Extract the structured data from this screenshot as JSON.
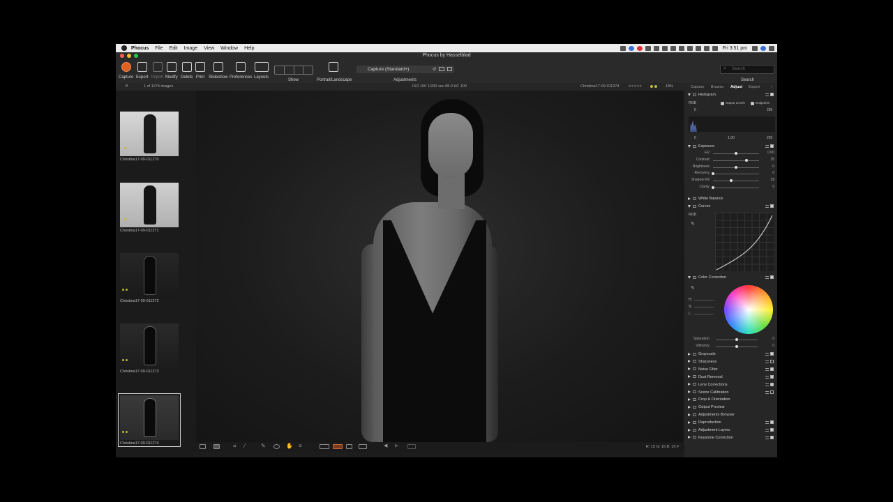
{
  "menubar": {
    "app": "Phocus",
    "items": [
      "File",
      "Edit",
      "Image",
      "View",
      "Window",
      "Help"
    ],
    "clock": "Fri 3:51 pm"
  },
  "window": {
    "title": "Phocus by Hasselblad"
  },
  "toolbar": {
    "buttons": [
      "Capture",
      "Export",
      "Import",
      "Modify",
      "Delete",
      "Print",
      "Slideshow",
      "Preferences",
      "Layouts"
    ],
    "show_label": "Show",
    "portrait_label": "Portrait/Landscape",
    "recipe_value": "Capture (Standard+)",
    "adjustments_label": "Adjustments",
    "search_placeholder": "Search",
    "search_label": "Search"
  },
  "infobar": {
    "filter": "ff",
    "count": "1 of 1274 images",
    "exposure": "ISO 100  1/200 sec  f/8.0  HC 100",
    "filename": "Christina17-09-011274",
    "zoom": "18%"
  },
  "thumbnails": [
    {
      "name": "Christina17-09-011270",
      "tone": "light"
    },
    {
      "name": "Christina17-09-011271",
      "tone": "light"
    },
    {
      "name": "Christina17-09-011272",
      "tone": "dark"
    },
    {
      "name": "Christina17-09-011273",
      "tone": "dark"
    },
    {
      "name": "Christina17-09-011274",
      "tone": "dark",
      "selected": true
    }
  ],
  "panel": {
    "tabs": [
      "Capture",
      "Browse",
      "Adjust",
      "Export"
    ],
    "active_tab": "Adjust",
    "histogram": {
      "title": "Histogram",
      "channel": "RGB",
      "output_levels": "Output Levels",
      "endpoints": "Endpoints",
      "min": "0",
      "max": "255",
      "low": "0",
      "mid": "1.00",
      "high": "255"
    },
    "exposure": {
      "title": "Exposure",
      "sliders": [
        {
          "label": "EV:",
          "value": "0.00",
          "pos": 0.5
        },
        {
          "label": "Contrast:",
          "value": "25",
          "pos": 0.72
        },
        {
          "label": "Brightness:",
          "value": "0",
          "pos": 0.5
        },
        {
          "label": "Recovery:",
          "value": "0",
          "pos": 0.0
        },
        {
          "label": "Shadow Fill:",
          "value": "39",
          "pos": 0.39
        },
        {
          "label": "Clarity:",
          "value": "0",
          "pos": 0.0
        }
      ]
    },
    "white_balance": "White Balance",
    "curves": {
      "title": "Curves",
      "channel": "RGB"
    },
    "color_correction": {
      "title": "Color Correction",
      "hsl": [
        "H:",
        "S:",
        "L:"
      ],
      "sliders": [
        {
          "label": "Saturation:",
          "value": "0",
          "pos": 0.5
        },
        {
          "label": "Vibrancy:",
          "value": "0",
          "pos": 0.5
        }
      ]
    },
    "tools": [
      {
        "label": "Grayscale",
        "checked": true
      },
      {
        "label": "Sharpness",
        "checked": false
      },
      {
        "label": "Noise Filter",
        "checked": true
      },
      {
        "label": "Dust Removal",
        "checked": true
      },
      {
        "label": "Lens Corrections",
        "checked": true
      },
      {
        "label": "Scene Calibration",
        "checked": false
      },
      {
        "label": "Crop & Orientation",
        "checked": null
      },
      {
        "label": "Output Preview",
        "checked": null
      },
      {
        "label": "Adjustments Browser",
        "checked": null
      },
      {
        "label": "Reproduction",
        "checked": true
      },
      {
        "label": "Adjustment Layers",
        "checked": true
      },
      {
        "label": "Keystone Correction",
        "checked": true
      }
    ]
  },
  "readout": "R:   15   G:   15   B:   15   #",
  "colors": {
    "accent": "#e0601f",
    "panel_bg": "#262626",
    "viewer_bg": "#1b1b1b"
  }
}
